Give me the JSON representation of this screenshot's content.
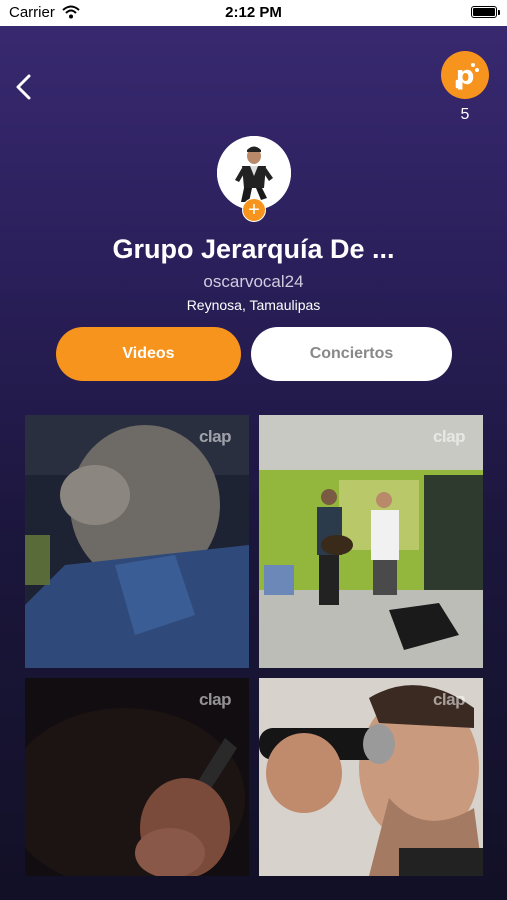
{
  "status_bar": {
    "carrier": "Carrier",
    "time": "2:12 PM"
  },
  "header": {
    "points": "5"
  },
  "profile": {
    "name": "Grupo Jerarquía De ...",
    "username": "oscarvocal24",
    "location": "Reynosa, Tamaulipas"
  },
  "tabs": [
    {
      "label": "Videos",
      "active": true
    },
    {
      "label": "Conciertos",
      "active": false
    }
  ],
  "videos": [
    {
      "watermark": "clap"
    },
    {
      "watermark": "clap"
    },
    {
      "watermark": "clap"
    },
    {
      "watermark": "clap"
    }
  ],
  "colors": {
    "accent": "#f7941d",
    "background_top": "#3a2a72",
    "background_bottom": "#121026"
  }
}
